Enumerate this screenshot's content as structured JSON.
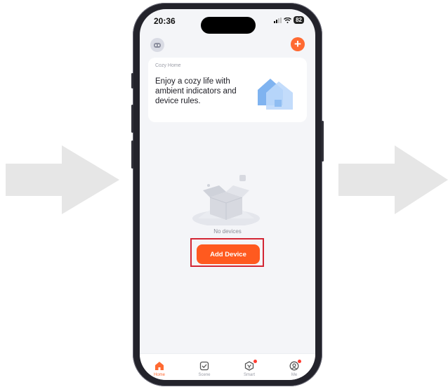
{
  "status_bar": {
    "time": "20:36",
    "battery": "82"
  },
  "header": {
    "avatar_icon": "avatar-icon",
    "add_icon": "plus-icon"
  },
  "banner": {
    "label": "Cozy Home",
    "text": "Enjoy a cozy life with ambient indicators and device rules.",
    "icon": "house-illustration"
  },
  "empty_state": {
    "message": "No devices",
    "button_label": "Add Device"
  },
  "tabbar": {
    "tabs": [
      {
        "label": "Home",
        "icon": "home-icon",
        "active": true
      },
      {
        "label": "Scene",
        "icon": "scene-check-icon",
        "active": false
      },
      {
        "label": "Smart",
        "icon": "smart-icon",
        "active": false,
        "badge": true
      },
      {
        "label": "Me",
        "icon": "profile-icon",
        "active": false,
        "badge": true
      }
    ]
  },
  "colors": {
    "accent": "#ff5a1f",
    "highlight": "#d32634",
    "arrow": "#e6e6e6"
  }
}
